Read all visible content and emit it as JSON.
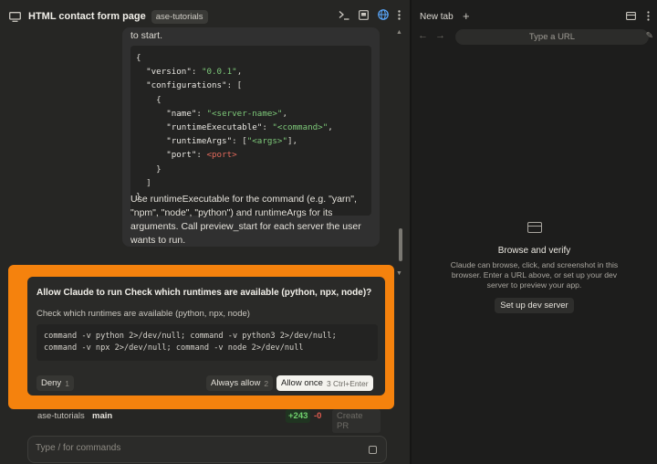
{
  "header": {
    "title": "HTML contact form page",
    "badge": "ase-tutorials",
    "icons": [
      "monitor-icon",
      "terminal-icon",
      "split-view-icon",
      "globe-icon",
      "more-icon"
    ]
  },
  "message": {
    "top_text": "to start.",
    "code_lines": [
      "{",
      "  \"version\": \"0.0.1\",",
      "  \"configurations\": [",
      "    {",
      "      \"name\": \"<server-name>\",",
      "      \"runtimeExecutable\": \"<command>\",",
      "      \"runtimeArgs\": [\"<args>\"],",
      "      \"port\": <port>",
      "    }",
      "  ]",
      "}"
    ],
    "body": "Use runtimeExecutable for the command (e.g. \"yarn\", \"npm\", \"node\", \"python\") and runtimeArgs for its arguments. Call preview_start for each server the user wants to run."
  },
  "dialog": {
    "title": "Allow Claude to run Check which runtimes are available (python, npx, node)?",
    "subtitle": "Check which runtimes are available (python, npx, node)",
    "command": "command -v python 2>/dev/null; command -v python3 2>/dev/null; command -v npx 2>/dev/null; command -v node 2>/dev/null",
    "deny_label": "Deny",
    "deny_hint": "1",
    "always_label": "Always allow",
    "always_hint": "2",
    "once_label": "Allow once",
    "once_hint": "3 Ctrl+Enter",
    "highlight_color": "#f5820d"
  },
  "git": {
    "repo": "ase-tutorials",
    "branch": "main",
    "added": "+243",
    "removed": "-0",
    "create_pr": "Create PR"
  },
  "composer": {
    "placeholder": "Type / for commands"
  },
  "browser": {
    "tab_label": "New tab",
    "url_placeholder": "Type a URL",
    "empty_title": "Browse and verify",
    "empty_desc": "Claude can browse, click, and screenshot in this browser. Enter a URL above, or set up your dev server to preview your app.",
    "setup_label": "Set up dev server"
  }
}
